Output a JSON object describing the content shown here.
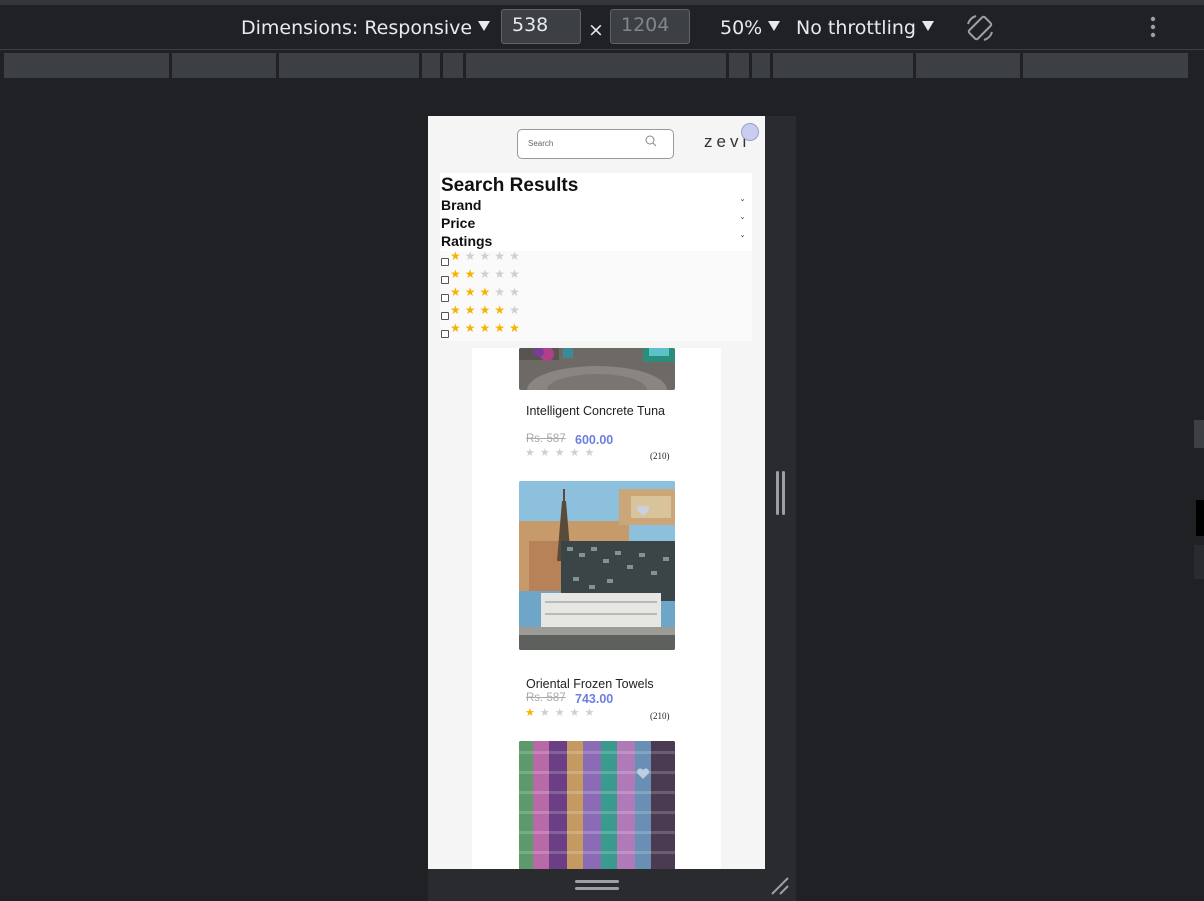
{
  "toolbar": {
    "dimensions_label": "Dimensions: Responsive",
    "width_value": "538",
    "height_placeholder": "1204",
    "times": "×",
    "zoom": "50%",
    "throttling": "No throttling",
    "rotate_icon": "rotate-icon",
    "more_icon": "more-vertical-icon"
  },
  "page": {
    "search_placeholder": "Search",
    "logo": "zevi",
    "title": "Search Results",
    "facets": [
      "Brand",
      "Price",
      "Ratings"
    ],
    "chevron": "ˇ",
    "ratings": [
      1,
      2,
      3,
      4,
      5
    ],
    "colors": {
      "accent": "#6b7fe0",
      "star": "#f4b400",
      "star_off": "#cfcfcf"
    }
  },
  "products": [
    {
      "name": "Intelligent Concrete Tuna",
      "old_price": "Rs. 587",
      "price": "600.00",
      "rating": 0,
      "reviews": "(210)"
    },
    {
      "name": "Oriental Frozen Towels",
      "old_price": "Rs. 587",
      "price": "743.00",
      "rating": 1,
      "reviews": "(210)"
    },
    {
      "name": "",
      "old_price": "",
      "price": "",
      "rating": 0,
      "reviews": ""
    }
  ]
}
